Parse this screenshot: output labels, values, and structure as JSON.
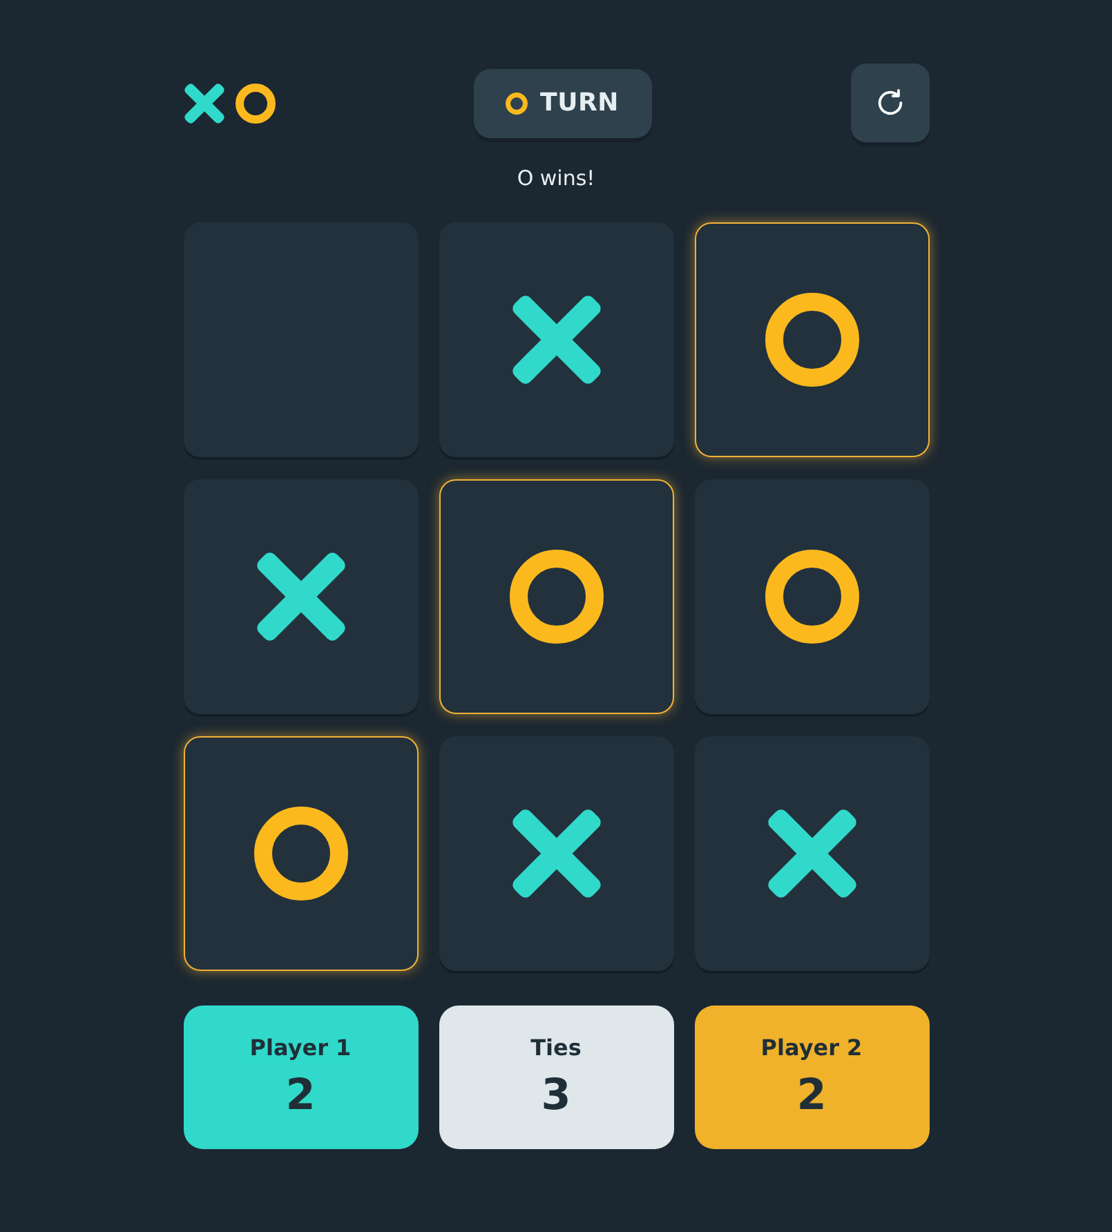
{
  "header": {
    "turn": {
      "kind": "o",
      "label": "TURN"
    }
  },
  "status": "O wins!",
  "board": {
    "cells": [
      {
        "kind": "empty",
        "highlighted": false
      },
      {
        "kind": "x",
        "highlighted": false
      },
      {
        "kind": "o",
        "highlighted": true
      },
      {
        "kind": "x",
        "highlighted": false
      },
      {
        "kind": "o",
        "highlighted": true
      },
      {
        "kind": "o",
        "highlighted": false
      },
      {
        "kind": "o",
        "highlighted": true
      },
      {
        "kind": "x",
        "highlighted": false
      },
      {
        "kind": "x",
        "highlighted": false
      }
    ]
  },
  "scores": [
    {
      "label": "Player 1",
      "value": "2",
      "color": "#31d9ca"
    },
    {
      "label": "Ties",
      "value": "3",
      "color": "#dfe7eb"
    },
    {
      "label": "Player 2",
      "value": "2",
      "color": "#f0b22b"
    }
  ]
}
